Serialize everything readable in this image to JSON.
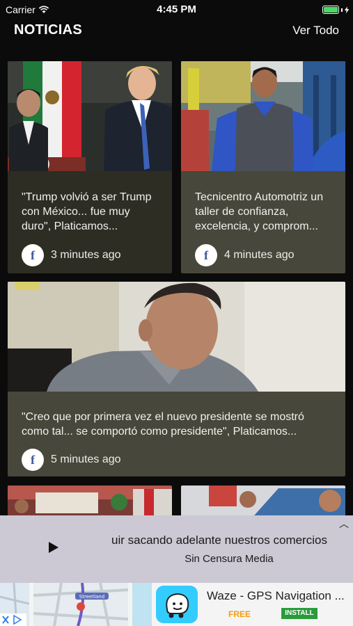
{
  "status_bar": {
    "carrier": "Carrier",
    "time": "4:45 PM"
  },
  "header": {
    "title": "NOTICIAS",
    "link": "Ver Todo"
  },
  "articles": [
    {
      "headline": "\"Trump volvió a ser Trump con México... fue muy duro\", Platicamos...",
      "time": "3 minutes ago",
      "source_icon": "facebook-icon"
    },
    {
      "headline": "Tecnicentro Automotriz un taller de confianza, excelencia, y comprom...",
      "time": "4 minutes ago",
      "source_icon": "facebook-icon"
    },
    {
      "headline": "\"Creo que por primera vez el nuevo presidente se mostró como tal... se comportó como presidente\", Platicamos...",
      "time": "5 minutes ago",
      "source_icon": "facebook-icon"
    }
  ],
  "player": {
    "track": "uir sacando adelante nuestros comercios",
    "artist": "Sin Censura Media"
  },
  "ad": {
    "app_name": "Waze - GPS Navigation ...",
    "price": "FREE",
    "cta": "INSTALL",
    "map_label": "Streetland"
  },
  "colors": {
    "battery": "#4cd964",
    "facebook": "#3b5998",
    "card_dark": "#2d2d24",
    "card_olive": "#48473b",
    "player_bg": "#ccc9d5"
  }
}
